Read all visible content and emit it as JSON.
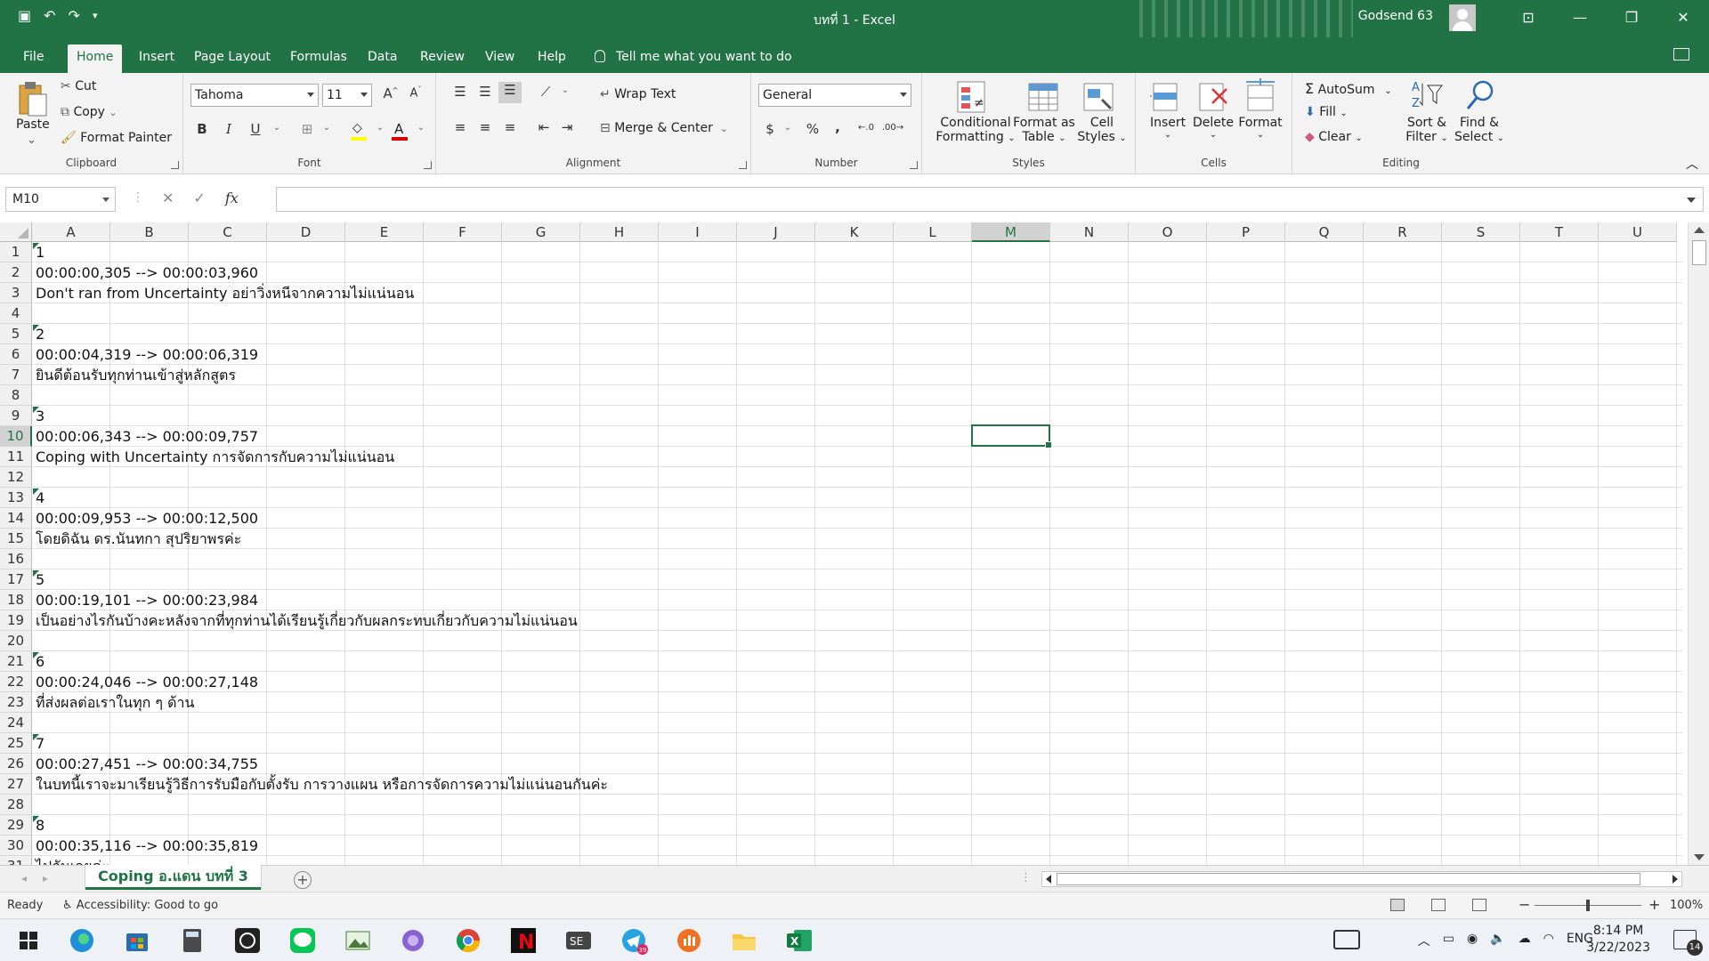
{
  "window": {
    "title": "บทที่ 1  -  Excel",
    "user": "Godsend 63"
  },
  "ribbon_tabs": [
    "File",
    "Home",
    "Insert",
    "Page Layout",
    "Formulas",
    "Data",
    "Review",
    "View",
    "Help"
  ],
  "active_tab": "Home",
  "tell_me": "Tell me what you want to do",
  "clipboard": {
    "paste": "Paste",
    "cut": "Cut",
    "copy": "Copy",
    "format_painter": "Format Painter",
    "label": "Clipboard"
  },
  "font": {
    "name": "Tahoma",
    "size": "11",
    "label": "Font"
  },
  "alignment": {
    "wrap_text": "Wrap Text",
    "merge_center": "Merge & Center",
    "label": "Alignment"
  },
  "number": {
    "format": "General",
    "label": "Number"
  },
  "styles": {
    "conditional_1": "Conditional",
    "conditional_2": "Formatting",
    "format_table_1": "Format as",
    "format_table_2": "Table",
    "cell_styles_1": "Cell",
    "cell_styles_2": "Styles",
    "label": "Styles"
  },
  "cells": {
    "insert": "Insert",
    "delete": "Delete",
    "format": "Format",
    "label": "Cells"
  },
  "editing": {
    "autosum": "AutoSum",
    "fill": "Fill",
    "clear": "Clear",
    "sort_1": "Sort &",
    "sort_2": "Filter",
    "find_1": "Find &",
    "find_2": "Select",
    "label": "Editing"
  },
  "formula_bar": {
    "name_box": "M10",
    "fx": "fx",
    "value": ""
  },
  "columns": [
    "A",
    "B",
    "C",
    "D",
    "E",
    "F",
    "G",
    "H",
    "I",
    "J",
    "K",
    "L",
    "M",
    "N",
    "O",
    "P",
    "Q",
    "R",
    "S",
    "T",
    "U"
  ],
  "selected_column": "M",
  "selected_row": 10,
  "rows": [
    {
      "n": "1",
      "a": "1"
    },
    {
      "n": "2",
      "a": "00:00:00,305 --> 00:00:03,960"
    },
    {
      "n": "3",
      "a": "Don't ran from Uncertainty อย่าวิ่งหนีจากความไม่แน่นอน"
    },
    {
      "n": "4",
      "a": ""
    },
    {
      "n": "5",
      "a": "2"
    },
    {
      "n": "6",
      "a": "00:00:04,319 --> 00:00:06,319"
    },
    {
      "n": "7",
      "a": "ยินดีต้อนรับทุกท่านเข้าสู่หลักสูตร"
    },
    {
      "n": "8",
      "a": ""
    },
    {
      "n": "9",
      "a": "3"
    },
    {
      "n": "10",
      "a": "00:00:06,343 --> 00:00:09,757"
    },
    {
      "n": "11",
      "a": "Coping with Uncertainty การจัดการกับความไม่แน่นอน"
    },
    {
      "n": "12",
      "a": ""
    },
    {
      "n": "13",
      "a": "4"
    },
    {
      "n": "14",
      "a": "00:00:09,953 --> 00:00:12,500"
    },
    {
      "n": "15",
      "a": "โดยดิฉัน ดร.นันทกา สุปริยาพรค่ะ"
    },
    {
      "n": "16",
      "a": ""
    },
    {
      "n": "17",
      "a": "5"
    },
    {
      "n": "18",
      "a": "00:00:19,101 --> 00:00:23,984"
    },
    {
      "n": "19",
      "a": "เป็นอย่างไรกันบ้างคะหลังจากที่ทุกท่านได้เรียนรู้เกี่ยวกับผลกระทบเกี่ยวกับความไม่แน่นอน"
    },
    {
      "n": "20",
      "a": ""
    },
    {
      "n": "21",
      "a": "6"
    },
    {
      "n": "22",
      "a": "00:00:24,046 --> 00:00:27,148"
    },
    {
      "n": "23",
      "a": "ที่ส่งผลต่อเราในทุก ๆ ด้าน"
    },
    {
      "n": "24",
      "a": ""
    },
    {
      "n": "25",
      "a": "7"
    },
    {
      "n": "26",
      "a": "00:00:27,451 --> 00:00:34,755"
    },
    {
      "n": "27",
      "a": "ในบทนี้เราจะมาเรียนรู้วิธีการรับมือกับตั้งรับ การวางแผน หรือการจัดการความไม่แน่นอนกันค่ะ"
    },
    {
      "n": "28",
      "a": ""
    },
    {
      "n": "29",
      "a": "8"
    },
    {
      "n": "30",
      "a": "00:00:35,116 --> 00:00:35,819"
    },
    {
      "n": "31",
      "a": "ไปกันเลยค่ะ"
    }
  ],
  "sheet_tab": "Coping อ.แดน บทที่ 3",
  "status": {
    "ready": "Ready",
    "accessibility": "Accessibility: Good to go",
    "zoom": "100%",
    "zoom_level": 100
  },
  "taskbar": {
    "lang": "ENG",
    "time": "8:14 PM",
    "date": "3/22/2023",
    "notifications": "14",
    "telegram_badge": "39"
  },
  "colors": {
    "excel_green": "#217346",
    "selected_header": "#d2d2d2"
  }
}
